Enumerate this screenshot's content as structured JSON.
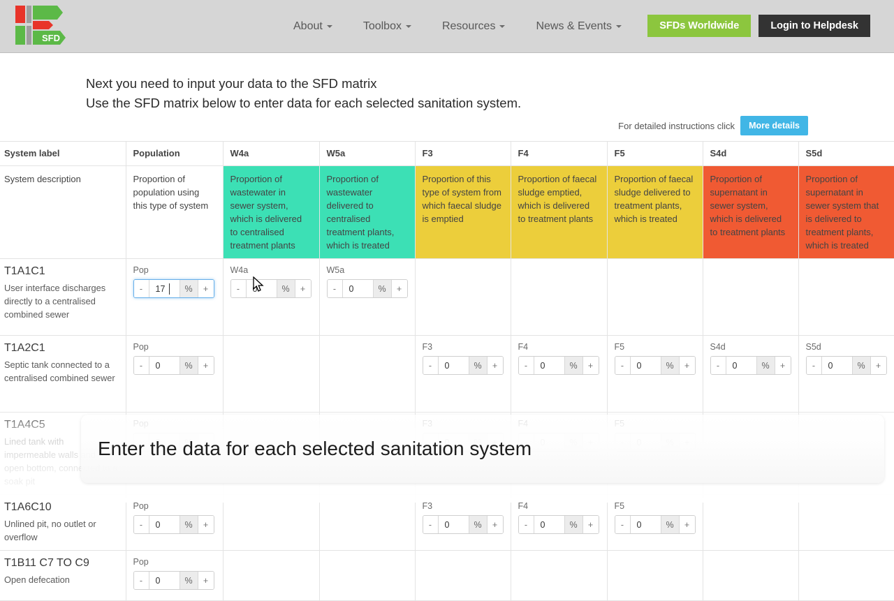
{
  "header": {
    "logo_text": "SFD",
    "nav": [
      {
        "label": "About"
      },
      {
        "label": "Toolbox"
      },
      {
        "label": "Resources"
      },
      {
        "label": "News & Events"
      }
    ],
    "buttons": {
      "worldwide": "SFDs Worldwide",
      "helpdesk": "Login to Helpdesk"
    },
    "colors": {
      "worldwide_bg": "#8cc63e",
      "helpdesk_bg": "#333333",
      "bar_bg": "#d6d6d6"
    }
  },
  "intro": {
    "line1": "Next you need to input your data to the SFD matrix",
    "line2": "Use the SFD matrix below to enter data for each selected sanitation system."
  },
  "details_hint": {
    "text": "For detailed instructions click",
    "button_label": "More details",
    "button_color": "#41b6e6"
  },
  "matrix": {
    "columns": [
      "System label",
      "Population",
      "W4a",
      "W5a",
      "F3",
      "F4",
      "F5",
      "S4d",
      "S5d"
    ],
    "description_row": {
      "label": "System description",
      "cells": [
        {
          "text": "Proportion of population using this type of system",
          "style": "plain"
        },
        {
          "text": "Proportion of wastewater in sewer system, which is delivered to centralised treatment plants",
          "style": "teal"
        },
        {
          "text": "Proportion of wastewater delivered to centralised treatment plants, which is treated",
          "style": "teal"
        },
        {
          "text": "Proportion of this type of system from which faecal sludge is emptied",
          "style": "yellow"
        },
        {
          "text": "Proportion of faecal sludge emptied, which is delivered to treatment plants",
          "style": "yellow"
        },
        {
          "text": "Proportion of faecal sludge delivered to treatment plants, which is treated",
          "style": "yellow"
        },
        {
          "text": "Proportion of supernatant in sewer system, which is delivered to treatment plants",
          "style": "red"
        },
        {
          "text": "Proportion of supernatant in sewer system that is delivered to treatment plants, which is treated",
          "style": "red"
        }
      ],
      "colors": {
        "teal": "#3ce0b5",
        "yellow": "#ecce3b",
        "red": "#f05a33"
      }
    },
    "stepper": {
      "minus": "-",
      "plus": "+",
      "unit": "%"
    },
    "rows": [
      {
        "code": "T1A1C1",
        "description": "User interface discharges directly to a centralised combined sewer",
        "fields": [
          {
            "label": "Pop",
            "value": "17",
            "focused": true
          },
          {
            "label": "W4a",
            "value": "0",
            "focused": false
          },
          {
            "label": "W5a",
            "value": "0",
            "focused": false
          },
          null,
          null,
          null,
          null,
          null
        ]
      },
      {
        "code": "T1A2C1",
        "description": "Septic tank connected to a centralised combined sewer",
        "fields": [
          {
            "label": "Pop",
            "value": "0",
            "focused": false
          },
          null,
          null,
          {
            "label": "F3",
            "value": "0",
            "focused": false
          },
          {
            "label": "F4",
            "value": "0",
            "focused": false
          },
          {
            "label": "F5",
            "value": "0",
            "focused": false
          },
          {
            "label": "S4d",
            "value": "0",
            "focused": false
          },
          {
            "label": "S5d",
            "value": "0",
            "focused": false
          }
        ]
      },
      {
        "code": "T1A4C5",
        "description": "Lined tank with impermeable walls and open bottom, connected to a soak pit",
        "fields": [
          {
            "label": "Pop",
            "value": "0",
            "focused": false
          },
          null,
          null,
          {
            "label": "F3",
            "value": "0",
            "focused": false
          },
          {
            "label": "F4",
            "value": "0",
            "focused": false
          },
          {
            "label": "F5",
            "value": "0",
            "focused": false
          },
          null,
          null
        ]
      },
      {
        "code": "T1A6C10",
        "description": "Unlined pit, no outlet or overflow",
        "fields": [
          {
            "label": "Pop",
            "value": "0",
            "focused": false
          },
          null,
          null,
          {
            "label": "F3",
            "value": "0",
            "focused": false
          },
          {
            "label": "F4",
            "value": "0",
            "focused": false
          },
          {
            "label": "F5",
            "value": "0",
            "focused": false
          },
          null,
          null
        ]
      },
      {
        "code": "T1B11 C7 TO C9",
        "description": "Open defecation",
        "fields": [
          {
            "label": "Pop",
            "value": "0",
            "focused": false
          },
          null,
          null,
          null,
          null,
          null,
          null,
          null
        ]
      }
    ]
  },
  "caption": {
    "text": "Enter the data for each selected sanitation system"
  }
}
